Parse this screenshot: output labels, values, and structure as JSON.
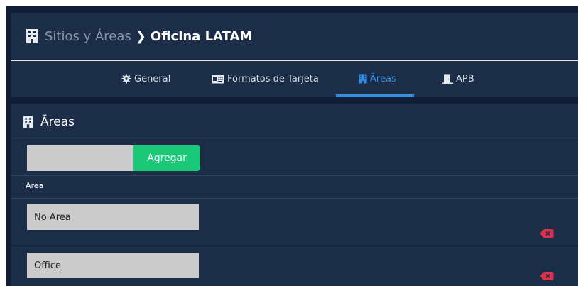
{
  "breadcrumb": {
    "parent": "Sitios y Áreas",
    "separator": "❯",
    "current": "Oficina LATAM"
  },
  "tabs": [
    {
      "label": "General",
      "icon": "gear-icon"
    },
    {
      "label": "Formatos de Tarjeta",
      "icon": "id-card-icon"
    },
    {
      "label": "Ãreas",
      "icon": "building-icon"
    },
    {
      "label": "APB",
      "icon": "door-icon"
    }
  ],
  "active_tab": "Ãreas",
  "areas_panel": {
    "title": "Ãreas",
    "add_input_value": "",
    "add_button": "Agregar",
    "column_header": "Area",
    "rows": [
      {
        "name": "No Area"
      },
      {
        "name": "Office"
      }
    ]
  },
  "colors": {
    "accent": "#2f8fe8",
    "add_button": "#1ac877",
    "delete": "#e0304a",
    "panel": "#1c2d48",
    "background": "#101d32"
  }
}
